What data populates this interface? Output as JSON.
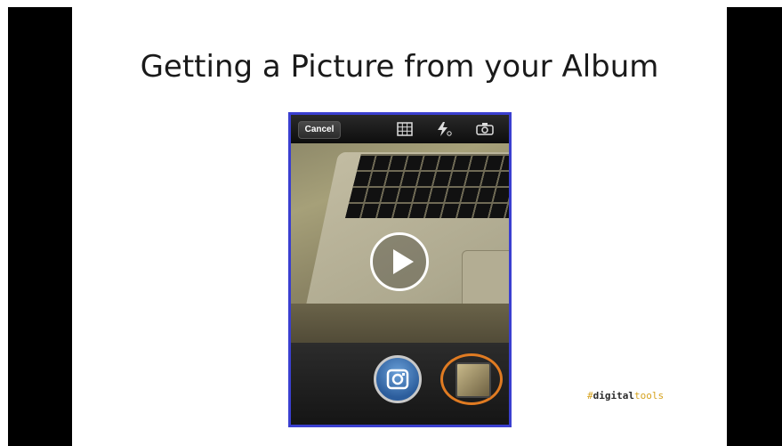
{
  "slide": {
    "title": "Getting a Picture from your Album"
  },
  "camera": {
    "cancel_label": "Cancel",
    "icons": [
      "grid-icon",
      "flash-icon",
      "camera-flip-icon",
      "play-icon",
      "shutter-camera-icon",
      "album-thumbnail-icon"
    ]
  },
  "brand": {
    "hash": "#",
    "digital": "digital",
    "tools": "tools"
  },
  "colors": {
    "phone_border": "#3a3fd0",
    "album_highlight": "#e07b22",
    "brand_accent": "#d6a21e"
  }
}
